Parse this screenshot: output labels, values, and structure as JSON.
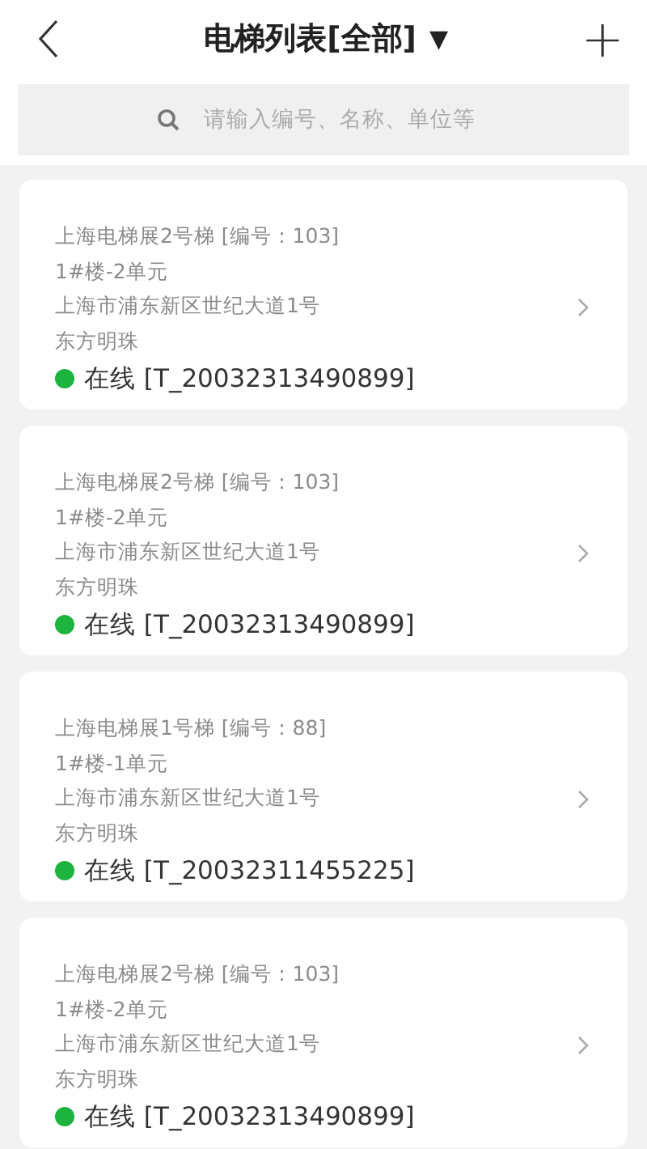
{
  "header": {
    "title": "电梯列表[全部]",
    "dropdown": "▼",
    "add": "+"
  },
  "search": {
    "placeholder": "请输入编号、名称、单位等"
  },
  "elevators": [
    {
      "name": "上海电梯展2号梯 [编号：103]",
      "unit": "1#楼-2单元",
      "address": "上海市浦东新区世纪大道1号",
      "building": "东方明珠",
      "status": "在线 [T_20032313490899]",
      "color": "#1db33f"
    },
    {
      "name": "上海电梯展2号梯 [编号：103]",
      "unit": "1#楼-2单元",
      "address": "上海市浦东新区世纪大道1号",
      "building": "东方明珠",
      "status": "在线 [T_20032313490899]",
      "color": "#1db33f"
    },
    {
      "name": "上海电梯展1号梯 [编号：88]",
      "unit": "1#楼-1单元",
      "address": "上海市浦东新区世纪大道1号",
      "building": "东方明珠",
      "status": "在线 [T_20032311455225]",
      "color": "#1db33f"
    },
    {
      "name": "上海电梯展2号梯 [编号：103]",
      "unit": "1#楼-2单元",
      "address": "上海市浦东新区世纪大道1号",
      "building": "东方明珠",
      "status": "在线 [T_20032313490899]",
      "color": "#1db33f"
    }
  ]
}
